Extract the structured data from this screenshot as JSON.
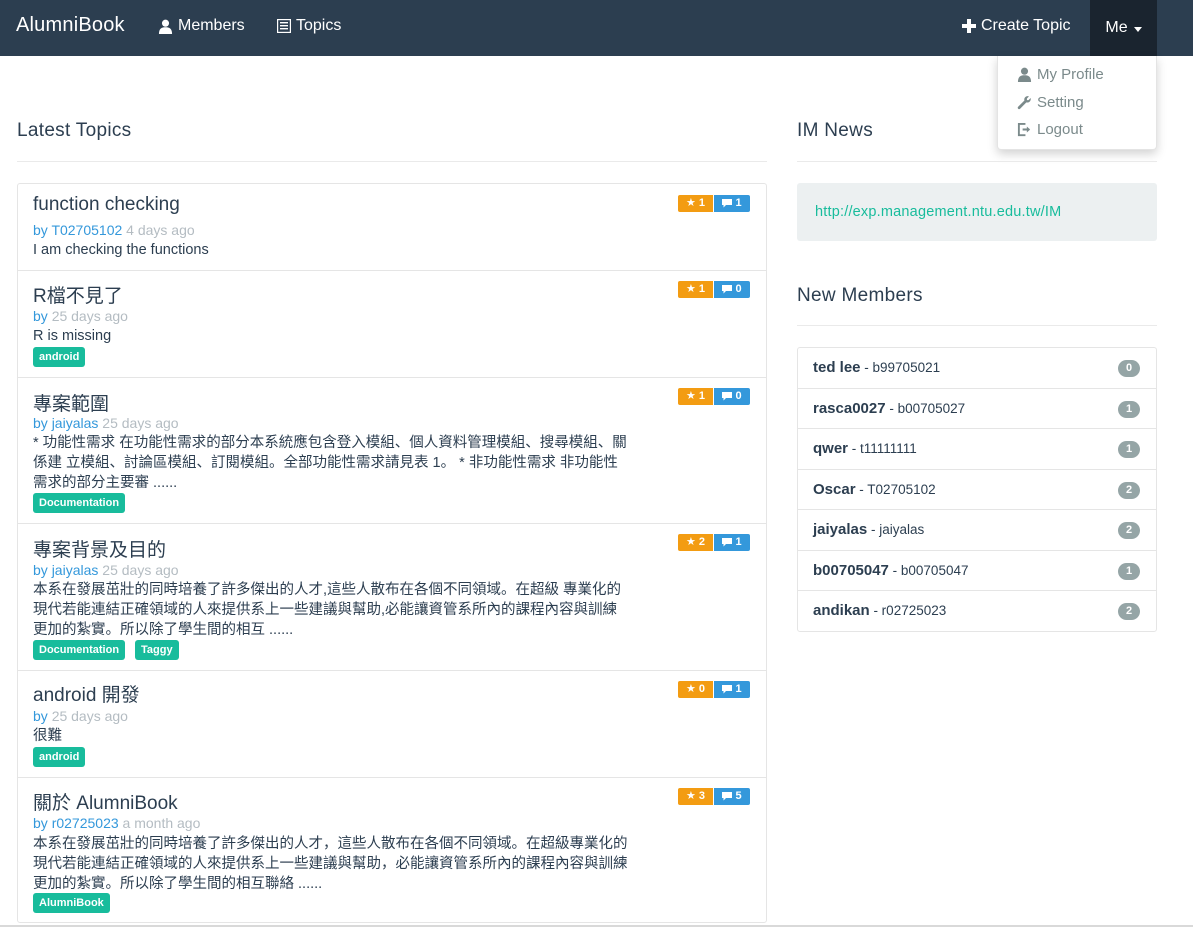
{
  "navbar": {
    "brand": "AlumniBook",
    "members": "Members",
    "topics": "Topics",
    "create_topic": "Create Topic",
    "me": "Me"
  },
  "dropdown": {
    "my_profile": "My Profile",
    "setting": "Setting",
    "logout": "Logout"
  },
  "latest_topics": {
    "heading": "Latest Topics",
    "items": [
      {
        "title": "function checking",
        "by": "by",
        "author": "T02705102",
        "time": "4 days ago",
        "body": "I am checking the functions",
        "tags": [],
        "stars": "1",
        "comments": "1"
      },
      {
        "title": "R檔不見了",
        "by": "by",
        "author": "",
        "time": "25 days ago",
        "body": "R is missing",
        "tags": [
          "android"
        ],
        "stars": "1",
        "comments": "0"
      },
      {
        "title": "專案範圍",
        "by": "by",
        "author": "jaiyalas",
        "time": "25 days ago",
        "body": "* 功能性需求 在功能性需求的部分本系統應包含登入模組、個人資料管理模組、搜尋模組、關係建 立模組、討論區模組、訂閱模組。全部功能性需求請見表 1。 * 非功能性需求 非功能性需求的部分主要審 ......",
        "tags": [
          "Documentation"
        ],
        "stars": "1",
        "comments": "0"
      },
      {
        "title": "專案背景及目的",
        "by": "by",
        "author": "jaiyalas",
        "time": "25 days ago",
        "body": "本系在發展茁壯的同時培養了許多傑出的人才,這些人散布在各個不同領域。在超級 專業化的現代若能連結正確領域的人來提供系上一些建議與幫助,必能讓資管系所內的課程內容與訓練更加的紮實。所以除了學生間的相互 ......",
        "tags": [
          "Documentation",
          "Taggy"
        ],
        "stars": "2",
        "comments": "1"
      },
      {
        "title": "android 開發",
        "by": "by",
        "author": "",
        "time": "25 days ago",
        "body": "很難",
        "tags": [
          "android"
        ],
        "stars": "0",
        "comments": "1"
      },
      {
        "title": "關於 AlumniBook",
        "by": "by",
        "author": "r02725023",
        "time": "a month ago",
        "body": "本系在發展茁壯的同時培養了許多傑出的人才，這些人散布在各個不同領域。在超級專業化的現代若能連結正確領域的人來提供系上一些建議與幫助，必能讓資管系所內的課程內容與訓練更加的紮實。所以除了學生間的相互聯絡 ......",
        "tags": [
          "AlumniBook"
        ],
        "stars": "3",
        "comments": "5"
      }
    ]
  },
  "im_news": {
    "heading": "IM News",
    "link": "http://exp.management.ntu.edu.tw/IM"
  },
  "new_members": {
    "heading": "New Members",
    "items": [
      {
        "name": "ted lee",
        "id": " - b99705021",
        "count": "0"
      },
      {
        "name": "rasca0027",
        "id": " - b00705027",
        "count": "1"
      },
      {
        "name": "qwer",
        "id": " - t11111111",
        "count": "1"
      },
      {
        "name": "Oscar",
        "id": " - T02705102",
        "count": "2"
      },
      {
        "name": "jaiyalas",
        "id": " - jaiyalas",
        "count": "2"
      },
      {
        "name": "b00705047",
        "id": " - b00705047",
        "count": "1"
      },
      {
        "name": "andikan",
        "id": " - r02725023",
        "count": "2"
      }
    ]
  },
  "colors": {
    "navbar": "#2c3e50",
    "accent_green": "#18bc9c",
    "star_orange": "#f39c12",
    "comment_blue": "#3498db",
    "badge_gray": "#95a5a6"
  },
  "icons": {
    "members": "user-icon",
    "topics": "list-icon",
    "create": "plus-icon",
    "profile": "user-icon",
    "setting": "wrench-icon",
    "logout": "logout-icon",
    "star": "star-icon",
    "comment": "comment-icon"
  }
}
